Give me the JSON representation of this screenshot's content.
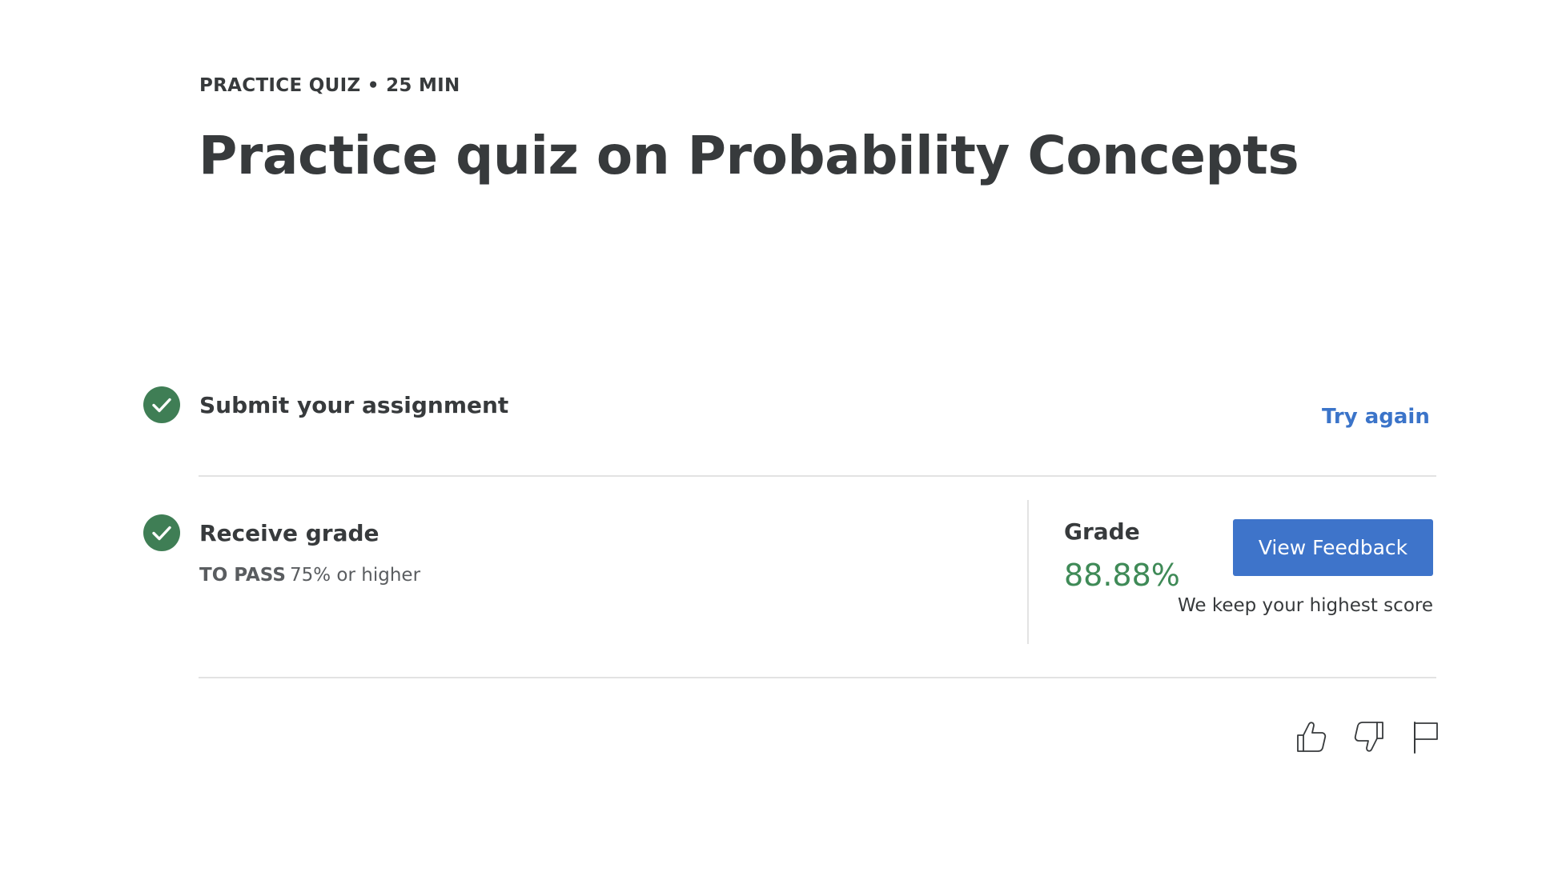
{
  "header": {
    "eyebrow": "PRACTICE QUIZ • 25 MIN",
    "title": "Practice quiz on Probability Concepts"
  },
  "steps": {
    "submit": {
      "title": "Submit your assignment",
      "action_label": "Try again",
      "status_icon": "check-circle-icon"
    },
    "grade": {
      "title": "Receive grade",
      "pass_label": "TO PASS",
      "pass_value": "75% or higher",
      "status_icon": "check-circle-icon",
      "grade_label": "Grade",
      "grade_value": "88.88%",
      "feedback_button": "View Feedback",
      "note": "We keep your highest score"
    }
  },
  "actions": {
    "icons": [
      "thumbs-up-icon",
      "thumbs-down-icon",
      "flag-icon"
    ]
  },
  "colors": {
    "success": "#3f7e55",
    "grade_text": "#3f8a57",
    "link": "#3b74c9",
    "primary_button": "#3e74ca",
    "text": "#373a3c"
  }
}
